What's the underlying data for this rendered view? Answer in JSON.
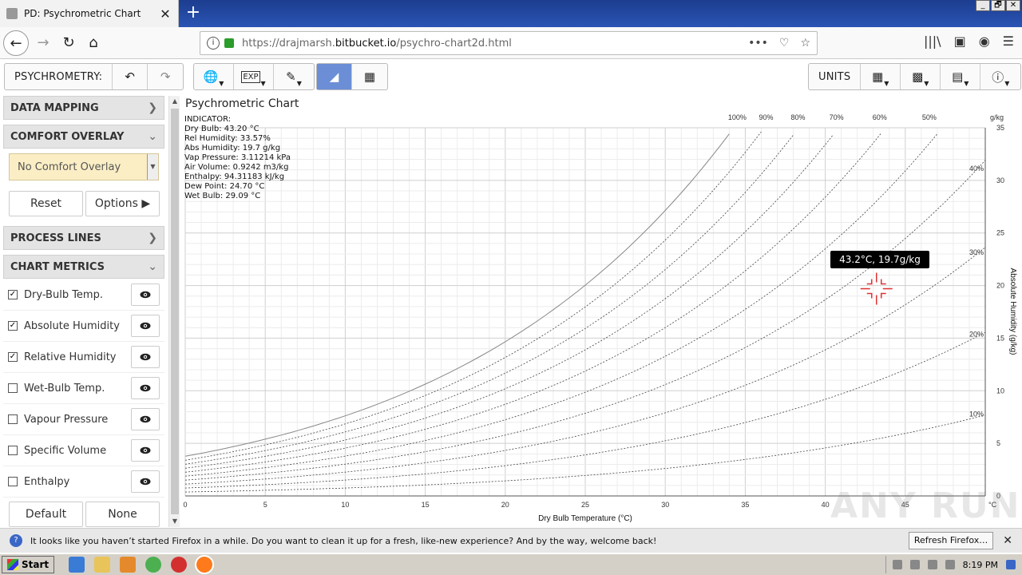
{
  "browser": {
    "tab_title": "PD: Psychrometric Chart",
    "tab_close": "✕",
    "new_tab": "+",
    "url_prefix": "https://drajmarsh.",
    "url_domain": "bitbucket.io",
    "url_path": "/psychro-chart2d.html",
    "window_controls": [
      "_",
      "🗗",
      "✕"
    ]
  },
  "toolbar": {
    "label": "PSYCHROMETRY:",
    "undo": "↶",
    "redo": "↷",
    "units_label": "UNITS"
  },
  "sidebar": {
    "data_mapping": "DATA MAPPING",
    "comfort_overlay": "COMFORT OVERLAY",
    "comfort_selected": "No Comfort Overlay",
    "reset_label": "Reset",
    "options_label": "Options",
    "process_lines": "PROCESS LINES",
    "chart_metrics": "CHART METRICS",
    "metrics": [
      {
        "label": "Dry-Bulb Temp.",
        "checked": true
      },
      {
        "label": "Absolute Humidity",
        "checked": true
      },
      {
        "label": "Relative Humidity",
        "checked": true
      },
      {
        "label": "Wet-Bulb Temp.",
        "checked": false
      },
      {
        "label": "Vapour Pressure",
        "checked": false
      },
      {
        "label": "Specific Volume",
        "checked": false
      },
      {
        "label": "Enthalpy",
        "checked": false
      }
    ],
    "default_label": "Default",
    "none_label": "None"
  },
  "chart": {
    "title": "Psychrometric Chart",
    "indicator": [
      "INDICATOR:",
      "Dry Bulb: 43.20 °C",
      "Rel Humidity: 33.57%",
      "Abs Humidity: 19.7 g/kg",
      "Vap Pressure: 3.11214 kPa",
      "Air Volume: 0.9242 m3/kg",
      "Enthalpy: 94.31183 kJ/kg",
      "Dew Point: 24.70 °C",
      "Wet Bulb: 29.09 °C"
    ],
    "tooltip": "43.2°C, 19.7g/kg",
    "colors": {
      "grid": "#d8d8d8",
      "curve": "#666666",
      "cursor": "#e03030"
    }
  },
  "chart_data": {
    "type": "line",
    "title": "Psychrometric Chart",
    "xlabel": "Dry Bulb Temperature (°C)",
    "ylabel": "Absolute Humidity (g/kg)",
    "x_unit": "°C",
    "y_unit": "g/kg",
    "xlim": [
      0,
      50
    ],
    "ylim": [
      0,
      35
    ],
    "x_ticks": [
      0,
      5,
      10,
      15,
      20,
      25,
      30,
      35,
      40,
      45
    ],
    "y_ticks": [
      0,
      5,
      10,
      15,
      20,
      25,
      30,
      35
    ],
    "rh_curves": [
      100,
      90,
      80,
      70,
      60,
      50,
      40,
      30,
      20,
      10
    ],
    "rh_top_labels": [
      "100%",
      "90%",
      "80%",
      "70%",
      "60%",
      "50%"
    ],
    "rh_side_labels": [
      "40%",
      "30%",
      "20%",
      "10%"
    ],
    "cursor_point": {
      "x": 43.2,
      "y": 19.7
    }
  },
  "notification": {
    "text": "It looks like you haven’t started Firefox in a while. Do you want to clean it up for a fresh, like-new experience? And by the way, welcome back!",
    "button": "Refresh Firefox…",
    "close": "✕"
  },
  "taskbar": {
    "start": "Start",
    "clock": "8:19 PM"
  },
  "watermark": "ANY RUN"
}
